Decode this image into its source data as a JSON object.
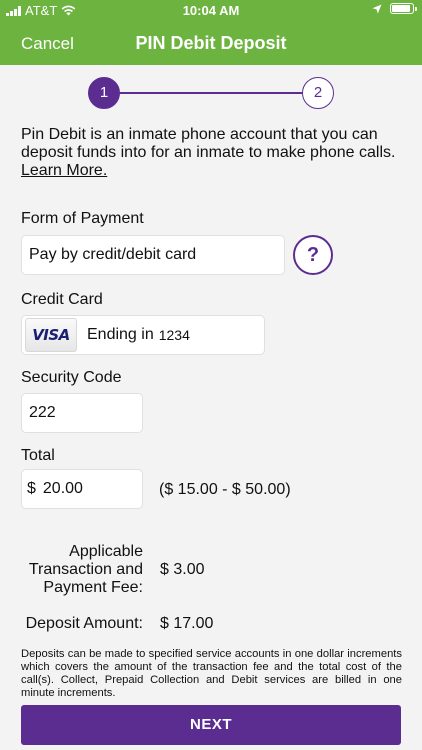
{
  "status_bar": {
    "carrier": "AT&T",
    "time": "10:04 AM",
    "icons": [
      "signal-icon",
      "wifi-icon",
      "location-icon",
      "battery-icon"
    ],
    "battery_level": 0.9
  },
  "nav": {
    "cancel_label": "Cancel",
    "title": "PIN Debit Deposit"
  },
  "stepper": {
    "steps": [
      "1",
      "2"
    ],
    "current_step": 1
  },
  "intro": {
    "text": "Pin Debit is an inmate phone account that you can deposit funds into for an inmate to make phone calls.",
    "learn_more": "Learn More."
  },
  "form_of_payment": {
    "label": "Form of Payment",
    "value": "Pay by credit/debit card",
    "help_label": "?"
  },
  "credit_card": {
    "label": "Credit Card",
    "brand": "VISA",
    "ending_prefix": "Ending in",
    "last_four": "1234"
  },
  "security_code": {
    "label": "Security Code",
    "value": "222"
  },
  "total": {
    "label": "Total",
    "currency": "$",
    "value": "20.00",
    "range": "($ 15.00 - $ 50.00)"
  },
  "fee": {
    "label": "Applicable Transaction and Payment Fee:",
    "value": "$ 3.00"
  },
  "deposit": {
    "label": "Deposit Amount:",
    "value": "$ 17.00"
  },
  "disclaimer": "Deposits can be made to specified service accounts in one dollar increments which covers the amount of the transaction fee and the total cost of the call(s). Collect, Prepaid Collection and Debit services are billed in one minute increments.",
  "next_label": "NEXT",
  "colors": {
    "header_green": "#6cb43f",
    "accent_purple": "#5c2d91",
    "background": "#f3f3f3"
  }
}
